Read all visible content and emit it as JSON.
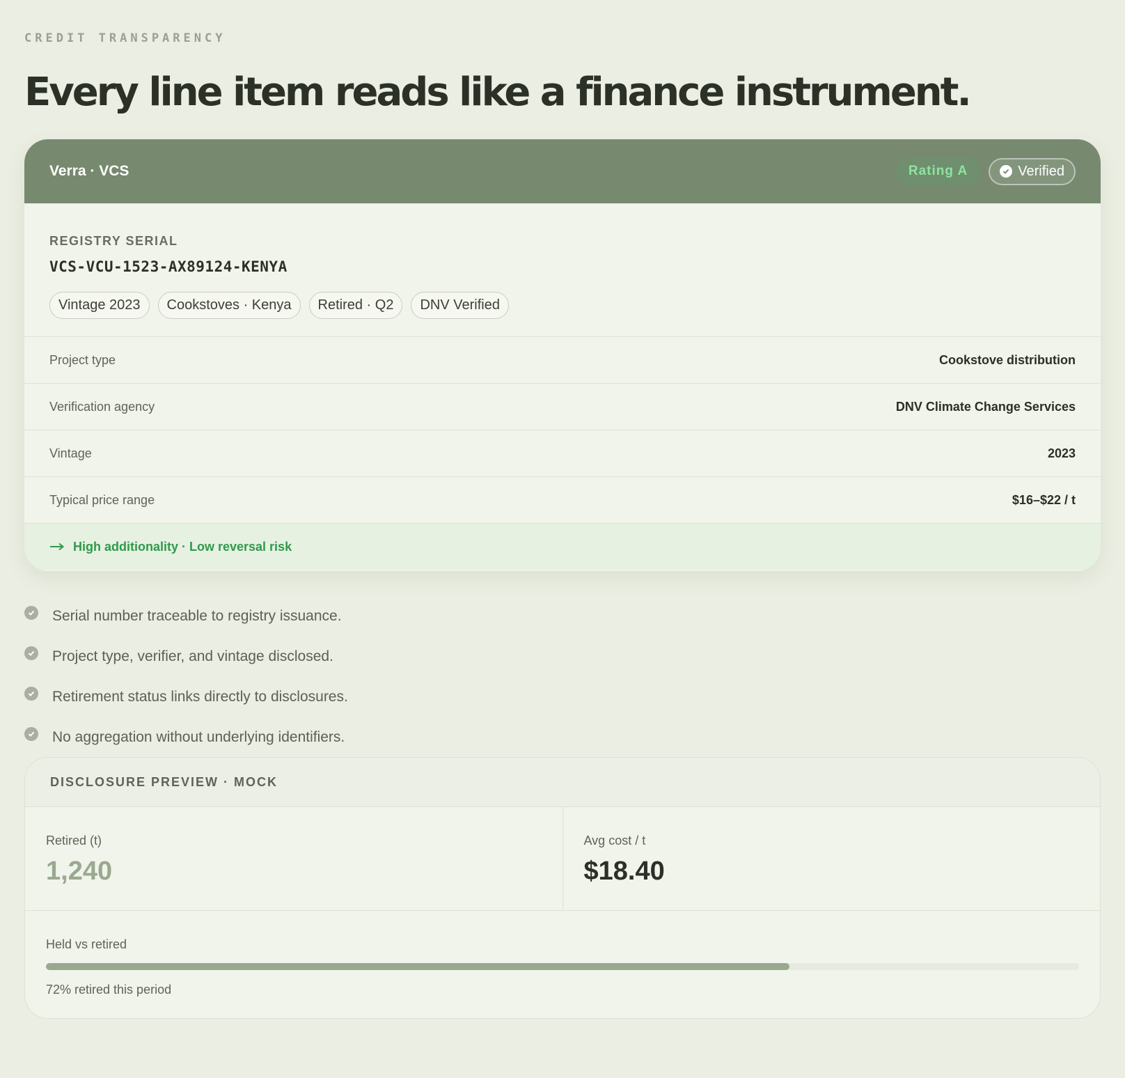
{
  "header": {
    "eyebrow": "CREDIT TRANSPARENCY",
    "headline": "Every line item reads like a finance instrument."
  },
  "credit_card": {
    "registry": "Verra · VCS",
    "rating": "Rating A",
    "verified": "Verified",
    "serial_label": "REGISTRY SERIAL",
    "serial": "VCS-VCU-1523-AX89124-KENYA",
    "chips": [
      "Vintage 2023",
      "Cookstoves · Kenya",
      "Retired · Q2",
      "DNV Verified"
    ],
    "details": [
      {
        "label": "Project type",
        "value": "Cookstove distribution"
      },
      {
        "label": "Verification agency",
        "value": "DNV Climate Change Services"
      },
      {
        "label": "Vintage",
        "value": "2023"
      },
      {
        "label": "Typical price range",
        "value": "$16–$22 / t"
      }
    ],
    "highlight": "High additionality · Low reversal risk"
  },
  "checklist": [
    "Serial number traceable to registry issuance.",
    "Project type, verifier, and vintage disclosed.",
    "Retirement status links directly to disclosures.",
    "No aggregation without underlying identifiers."
  ],
  "disclosure": {
    "title": "DISCLOSURE PREVIEW · MOCK",
    "metrics": [
      {
        "label": "Retired (t)",
        "value": "1,240"
      },
      {
        "label": "Avg cost / t",
        "value": "$18.40"
      }
    ],
    "progress_label": "Held vs retired",
    "progress_fraction": 0.72,
    "progress_caption": "72% retired this period"
  },
  "colors": {
    "accent_green": "#2f9a4a",
    "header_bg": "#77896f",
    "progress_fill": "#9aa88f"
  }
}
